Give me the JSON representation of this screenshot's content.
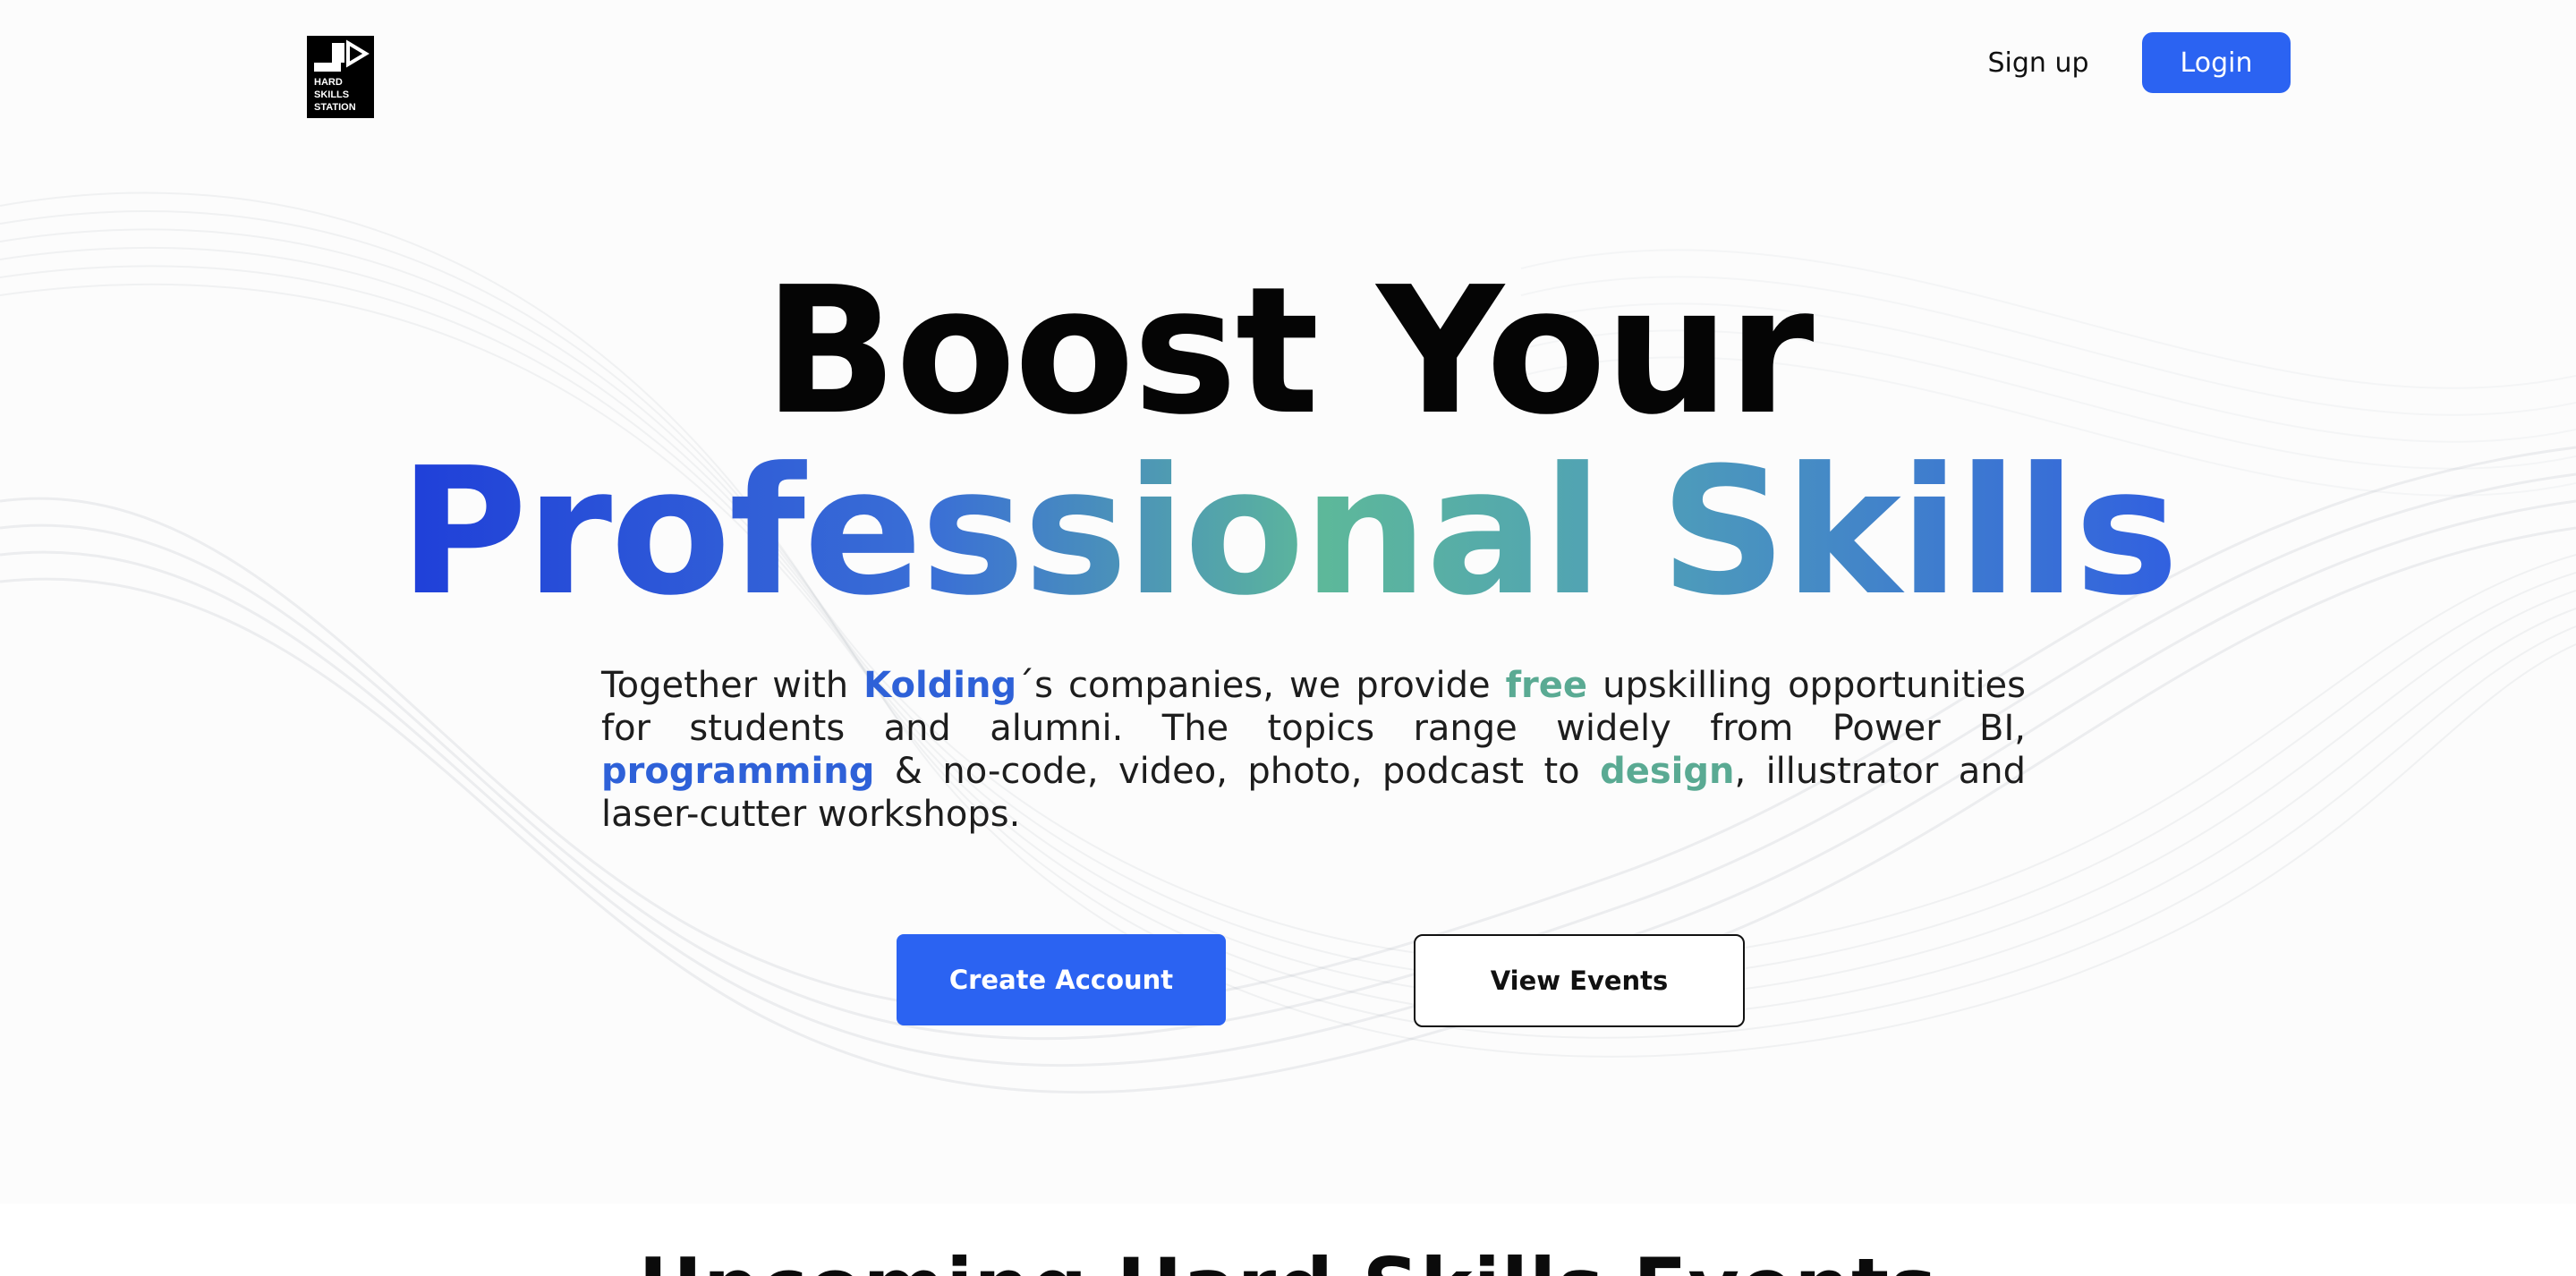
{
  "brand": {
    "logo_name": "hard-skills-station-logo",
    "logo_text_lines": [
      "HARD",
      "SKILLS",
      "STATION"
    ]
  },
  "nav": {
    "signup_label": "Sign up",
    "login_label": "Login"
  },
  "hero": {
    "title_line1": "Boost Your",
    "title_line2": "Professional Skills",
    "paragraph": {
      "p1": "Together with ",
      "kolding": "Kolding",
      "p2": "´s companies, we provide ",
      "free": "free",
      "p3": " upskilling opportunities for students and alumni. The topics range widely from Power BI, ",
      "programming": "programming",
      "p4": " & no-code, video, photo, podcast to ",
      "design": "design",
      "p5": ", illustrator and laser-cutter workshops."
    }
  },
  "cta": {
    "create_account_label": "Create Account",
    "view_events_label": "View Events"
  },
  "next_section": {
    "heading_peek": "Upcoming Hard Skills Events"
  },
  "colors": {
    "accent_blue": "#2b63f2",
    "highlight_blue": "#2e61d8",
    "highlight_teal": "#5aaa93",
    "gradient_start": "#1f3fd9",
    "gradient_mid": "#5db89a",
    "gradient_end": "#3160e0"
  }
}
